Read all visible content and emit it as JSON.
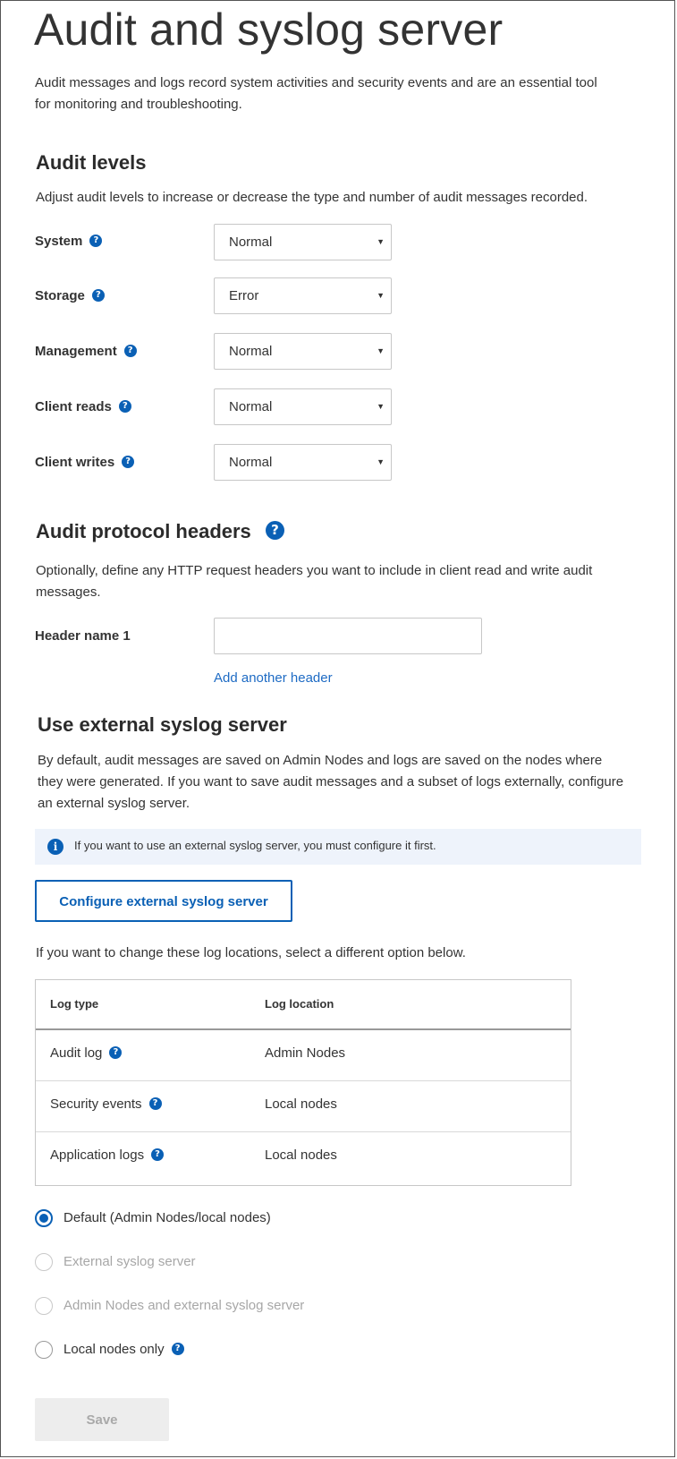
{
  "page": {
    "title": "Audit and syslog server",
    "intro": "Audit messages and logs record system activities and security events and are an essential tool for monitoring and troubleshooting."
  },
  "audit_levels": {
    "title": "Audit levels",
    "description": "Adjust audit levels to increase or decrease the type and number of audit messages recorded.",
    "rows": [
      {
        "label": "System",
        "value": "Normal"
      },
      {
        "label": "Storage",
        "value": "Error"
      },
      {
        "label": "Management",
        "value": "Normal"
      },
      {
        "label": "Client reads",
        "value": "Normal"
      },
      {
        "label": "Client writes",
        "value": "Normal"
      }
    ]
  },
  "protocol_headers": {
    "title": "Audit protocol headers",
    "description": "Optionally, define any HTTP request headers you want to include in client read and write audit messages.",
    "header_label": "Header name 1",
    "header_value": "",
    "add_link": "Add another header"
  },
  "syslog": {
    "title": "Use external syslog server",
    "description": "By default, audit messages are saved on Admin Nodes and logs are saved on the nodes where they were generated. If you want to save audit messages and a subset of logs externally, configure an external syslog server.",
    "info": "If you want to use an external syslog server, you must configure it first.",
    "configure_button": "Configure external syslog server",
    "change_text": "If you want to change these log locations, select a different option below.",
    "table": {
      "headers": [
        "Log type",
        "Log location"
      ],
      "rows": [
        {
          "type": "Audit log",
          "location": "Admin Nodes"
        },
        {
          "type": "Security events",
          "location": "Local nodes"
        },
        {
          "type": "Application logs",
          "location": "Local nodes"
        }
      ]
    },
    "options": [
      {
        "label": "Default (Admin Nodes/local nodes)",
        "checked": true,
        "disabled": false
      },
      {
        "label": "External syslog server",
        "checked": false,
        "disabled": true
      },
      {
        "label": "Admin Nodes and external syslog server",
        "checked": false,
        "disabled": true
      },
      {
        "label": "Local nodes only",
        "checked": false,
        "disabled": false
      }
    ]
  },
  "footer": {
    "save_label": "Save"
  },
  "icons": {
    "help": "question-icon",
    "info": "info-icon",
    "dropdown": "caret-down-icon"
  },
  "colors": {
    "accent": "#0a60b5",
    "link": "#1e6bc4",
    "info_bg": "#eef3fb",
    "disabled_text": "#a7a7a7"
  }
}
